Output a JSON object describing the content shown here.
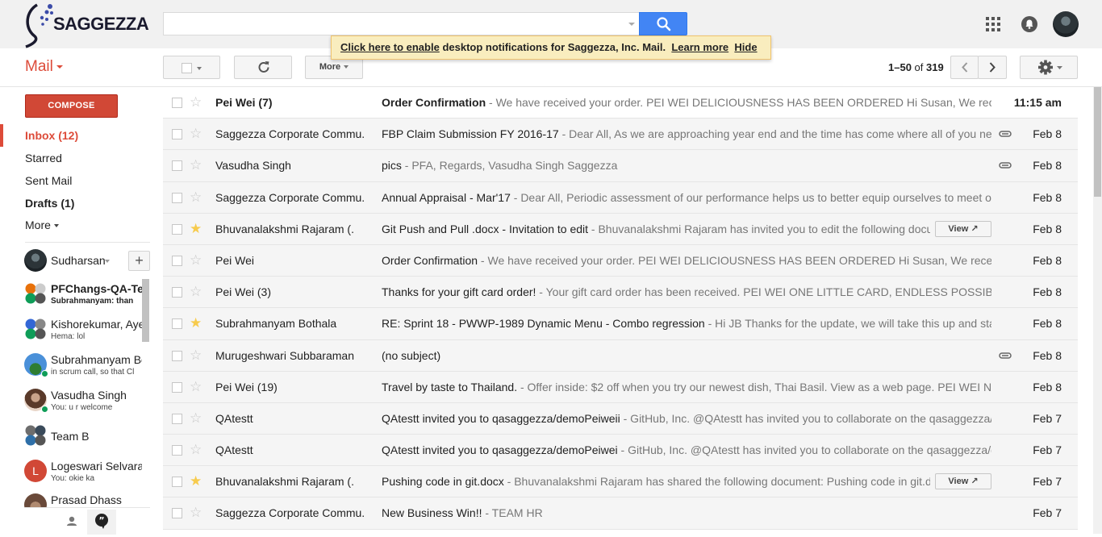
{
  "header": {
    "logo_text": "SAGGEZZA",
    "search_placeholder": "",
    "notification": {
      "enable_link": "Click here to enable",
      "message": "desktop notifications for Saggezza, Inc. Mail.",
      "learn_more": "Learn more",
      "hide": "Hide"
    }
  },
  "toolbar": {
    "mail_label": "Mail",
    "more_label": "More",
    "pager_range": "1–50",
    "pager_of": "of",
    "pager_total": "319"
  },
  "nav": {
    "compose": "COMPOSE",
    "items": [
      {
        "label": "Inbox (12)"
      },
      {
        "label": "Starred"
      },
      {
        "label": "Sent Mail"
      },
      {
        "label": "Drafts (1)"
      },
      {
        "label": "More"
      }
    ]
  },
  "hangouts": {
    "me": "Sudharsan",
    "add": "+",
    "chats": [
      {
        "name": "PFChangs-QA-Tea",
        "status": "Subrahmanyam: than"
      },
      {
        "name": "Kishorekumar, Aye",
        "status": "Hema: lol"
      },
      {
        "name": "Subrahmanyam Bo",
        "status": "in scrum call, so that Cl"
      },
      {
        "name": "Vasudha Singh",
        "status": "You: u r welcome"
      },
      {
        "name": "Team B",
        "status": ""
      },
      {
        "name": "Logeswari Selvaraj",
        "status": "You: okie ka",
        "initial": "L"
      },
      {
        "name": "Prasad Dhass",
        "status": ""
      }
    ]
  },
  "emails": [
    {
      "sender": "Pei Wei (7)",
      "subject": "Order Confirmation",
      "snippet": " - We have received your order. PEI WEI DELICIOUSNESS HAS BEEN ORDERED Hi Susan, We received your order",
      "date": "11:15 am"
    },
    {
      "sender": "Saggezza Corporate Commu.",
      "subject": "FBP Claim Submission FY 2016-17",
      "snippet": " - Dear All, As we are approaching year end and the time has come where all of you need to submit",
      "date": "Feb 8"
    },
    {
      "sender": "Vasudha Singh",
      "subject": "pics",
      "snippet": " - PFA, Regards, Vasudha Singh Saggezza",
      "date": "Feb 8"
    },
    {
      "sender": "Saggezza Corporate Commu.",
      "subject": "Annual Appraisal - Mar'17",
      "snippet": " - Dear All, Periodic assessment of our performance helps us to better equip ourselves to meet our goals and",
      "date": "Feb 8"
    },
    {
      "sender": "Bhuvanalakshmi Rajaram (.",
      "subject": "Git Push and Pull .docx - Invitation to edit",
      "snippet": " - Bhuvanalakshmi Rajaram has invited you to edit the following document: Git",
      "date": "Feb 8",
      "view": "View ↗"
    },
    {
      "sender": "Pei Wei",
      "subject": "Order Confirmation",
      "snippet": " - We have received your order. PEI WEI DELICIOUSNESS HAS BEEN ORDERED Hi Susan, We received your order",
      "date": "Feb 8"
    },
    {
      "sender": "Pei Wei (3)",
      "subject": "Thanks for your gift card order!",
      "snippet": " - Your gift card order has been received. PEI WEI ONE LITTLE CARD, ENDLESS POSSIBILITIES We",
      "date": "Feb 8"
    },
    {
      "sender": "Subrahmanyam Bothala",
      "subject": "RE: Sprint 18 - PWWP-1989 Dynamic Menu - Combo regression",
      "snippet": " - Hi JB Thanks for the update, we will take this up and start validation",
      "date": "Feb 8"
    },
    {
      "sender": "Murugeshwari Subbaraman",
      "subject": "(no subject)",
      "snippet": "",
      "date": "Feb 8"
    },
    {
      "sender": "Pei Wei (19)",
      "subject": "Travel by taste to Thailand.",
      "snippet": " - Offer inside: $2 off when you try our newest dish, Thai Basil. View as a web page. PEI WEI No passport",
      "date": "Feb 8"
    },
    {
      "sender": "QAtestt",
      "subject": "QAtestt invited you to qasaggezza/demoPeiweii",
      "snippet": " - GitHub, Inc. @QAtestt has invited you to collaborate on the qasaggezza/demoPeiweii",
      "date": "Feb 7"
    },
    {
      "sender": "QAtestt",
      "subject": "QAtestt invited you to qasaggezza/demoPeiwei",
      "snippet": " - GitHub, Inc. @QAtestt has invited you to collaborate on the qasaggezza/demoPeiwei",
      "date": "Feb 7"
    },
    {
      "sender": "Bhuvanalakshmi Rajaram (.",
      "subject": "Pushing code in git.docx",
      "snippet": " - Bhuvanalakshmi Rajaram has shared the following document: Pushing code in git.docx Open",
      "date": "Feb 7",
      "view": "View ↗"
    },
    {
      "sender": "Saggezza Corporate Commu.",
      "subject": "New Business Win!!",
      "snippet": " - TEAM HR",
      "date": "Feb 7"
    }
  ],
  "colors": {
    "accent": "#dd4b39",
    "compose": "#d14836",
    "search": "#4285f4",
    "star": "#f7cb4d"
  }
}
